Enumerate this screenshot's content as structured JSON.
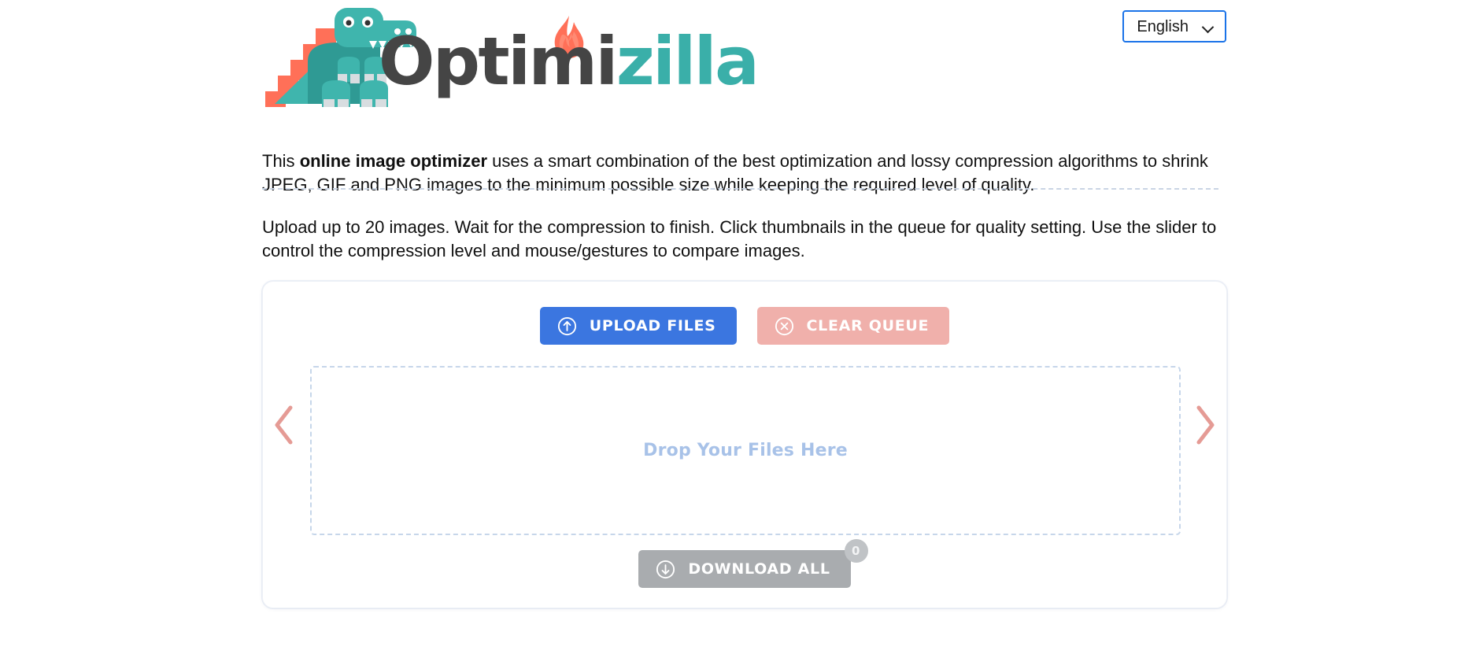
{
  "header": {
    "logo": {
      "word_dark": "Optimi",
      "word_teal": "zilla",
      "mascot_icon": "dinosaur-icon",
      "flame_icon": "flame-icon",
      "teal": "#3aafa9",
      "dark": "#454545",
      "coral": "#ff7058"
    },
    "language_select": {
      "value": "English",
      "icon": "chevron-down-icon"
    }
  },
  "intro": {
    "line1_prefix": "This ",
    "line1_bold": "online image optimizer",
    "line1_suffix": " uses a smart combination of the best optimization and lossy compression algorithms to shrink JPEG, GIF and PNG images to the minimum possible size while keeping the required level of quality.",
    "line2": "Upload up to 20 images. Wait for the compression to finish. Click thumbnails in the queue for quality setting. Use the slider to control the compression level and mouse/gestures to compare images."
  },
  "queue": {
    "upload_button": {
      "label": "UPLOAD FILES",
      "icon": "upload-arrow-circle-icon",
      "color": "#3b76e0"
    },
    "clear_button": {
      "label": "CLEAR QUEUE",
      "icon": "close-circle-icon",
      "color": "#f0b0ab"
    },
    "dropzone": {
      "text": "Drop Your Files Here"
    },
    "prev_arrow_icon": "chevron-left-icon",
    "next_arrow_icon": "chevron-right-icon",
    "download_button": {
      "label": "DOWNLOAD ALL",
      "icon": "download-arrow-circle-icon",
      "badge": "0",
      "color": "#a9acaf"
    }
  }
}
